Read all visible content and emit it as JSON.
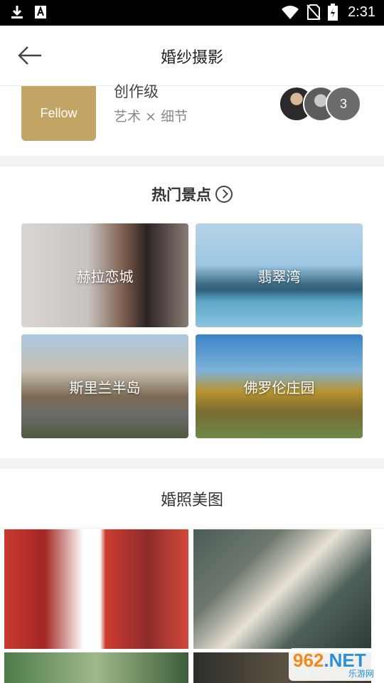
{
  "status_bar": {
    "time": "2:31",
    "icons": [
      "download-icon",
      "a-icon",
      "wifi-icon",
      "no-sim-icon",
      "battery-icon"
    ]
  },
  "header": {
    "title": "婚纱摄影"
  },
  "photographer_tier": {
    "badge": "Fellow",
    "name": "创作级",
    "subtitle": "艺术 × 细节",
    "more_count": "3"
  },
  "hot_spots": {
    "title": "热门景点",
    "items": [
      {
        "label": "赫拉恋城"
      },
      {
        "label": "翡翠湾"
      },
      {
        "label": "斯里兰半岛"
      },
      {
        "label": "佛罗伦庄园"
      }
    ]
  },
  "gallery": {
    "title": "婚照美图"
  },
  "watermark": {
    "num": "962",
    "net": ".NET",
    "sub": "乐游网"
  }
}
